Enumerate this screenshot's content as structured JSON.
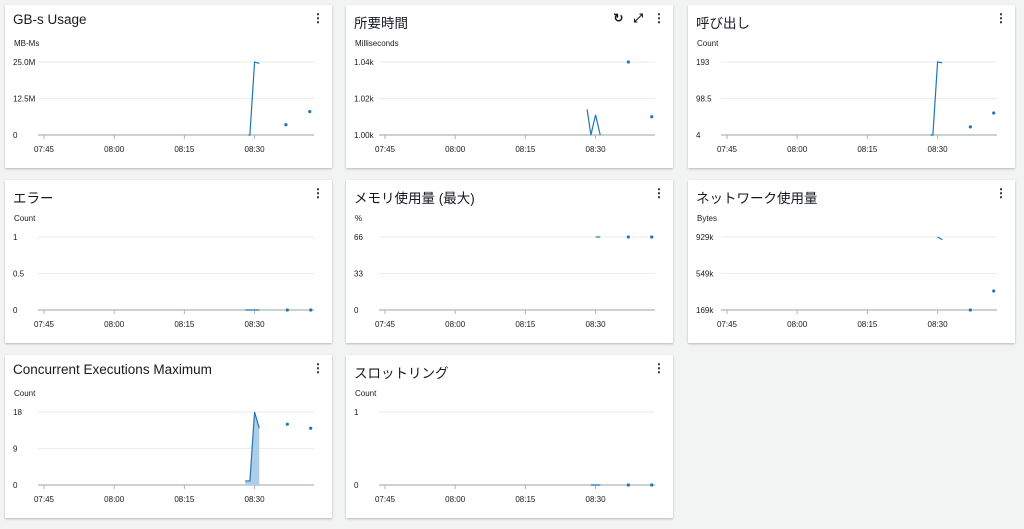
{
  "colors": {
    "line": "#1f77b4",
    "fill": "#aecde6",
    "grid": "#eaeded",
    "axis": "#aab7b8"
  },
  "x_ticks": [
    "07:45",
    "08:00",
    "08:15",
    "08:30"
  ],
  "x_range": [
    "07:45",
    "08:42.7"
  ],
  "chart_data": [
    {
      "type": "line",
      "title": "GB-s Usage",
      "unit": "MB-Ms",
      "yticks": [
        "0",
        "12.5M",
        "25.0M"
      ],
      "ylim": [
        0,
        25000000
      ],
      "line": [
        [
          "08:28.7",
          0
        ],
        [
          "08:29",
          0
        ],
        [
          "08:30",
          25000000
        ],
        [
          "08:31",
          24500000
        ]
      ],
      "dots": [
        [
          "08:36.7",
          3500000
        ],
        [
          "08:41.8",
          8000000
        ]
      ]
    },
    {
      "type": "line",
      "title": "所要時間",
      "unit": "Milliseconds",
      "yticks": [
        "1.00k",
        "1.02k",
        "1.04k"
      ],
      "ylim": [
        1000,
        1040
      ],
      "extra_tools": true,
      "line": [
        [
          "08:28.2",
          1014
        ],
        [
          "08:29",
          1000
        ],
        [
          "08:30",
          1011
        ],
        [
          "08:31",
          1000
        ]
      ],
      "dots": [
        [
          "08:37",
          1040
        ],
        [
          "08:42",
          1010
        ]
      ]
    },
    {
      "type": "line",
      "title": "呼び出し",
      "unit": "Count",
      "yticks": [
        "4",
        "98.5",
        "193"
      ],
      "ylim": [
        4,
        193
      ],
      "line": [
        [
          "08:28.5",
          4
        ],
        [
          "08:29",
          4
        ],
        [
          "08:30",
          193
        ],
        [
          "08:31",
          191
        ]
      ],
      "dots": [
        [
          "08:37",
          25
        ],
        [
          "08:42",
          61
        ]
      ]
    },
    {
      "type": "line",
      "title": "エラー",
      "unit": "Count",
      "yticks": [
        "0",
        "0.5",
        "1"
      ],
      "ylim": [
        0,
        1
      ],
      "line": [
        [
          "08:28",
          0
        ],
        [
          "08:31",
          0
        ]
      ],
      "dots": [
        [
          "08:37",
          0
        ],
        [
          "08:42",
          0
        ]
      ]
    },
    {
      "type": "line",
      "title": "メモリ使用量 (最大)",
      "unit": "%",
      "yticks": [
        "0",
        "33",
        "66"
      ],
      "ylim": [
        0,
        66
      ],
      "line": [
        [
          "08:30",
          66
        ],
        [
          "08:31",
          66
        ]
      ],
      "dots": [
        [
          "08:37",
          66
        ],
        [
          "08:42",
          66
        ]
      ]
    },
    {
      "type": "line",
      "title": "ネットワーク使用量",
      "unit": "Bytes",
      "yticks": [
        "169k",
        "549k",
        "929k"
      ],
      "ylim": [
        169,
        929
      ],
      "line": [
        [
          "08:30",
          929
        ],
        [
          "08:31",
          900
        ]
      ],
      "dots": [
        [
          "08:37",
          169
        ],
        [
          "08:42",
          367
        ]
      ]
    },
    {
      "type": "area",
      "title": "Concurrent Executions Maximum",
      "unit": "Count",
      "yticks": [
        "0",
        "9",
        "18"
      ],
      "ylim": [
        0,
        18
      ],
      "line": [
        [
          "08:28",
          1
        ],
        [
          "08:29",
          1
        ],
        [
          "08:30",
          18
        ],
        [
          "08:31",
          14
        ]
      ],
      "dots": [
        [
          "08:37",
          15
        ],
        [
          "08:42",
          14
        ]
      ]
    },
    {
      "type": "line",
      "title": "スロットリング",
      "unit": "Count",
      "yticks": [
        "0",
        "1"
      ],
      "ylim": [
        0,
        1
      ],
      "line": [
        [
          "08:29",
          0
        ],
        [
          "08:31",
          0
        ]
      ],
      "dots": [
        [
          "08:37",
          0
        ],
        [
          "08:42",
          0
        ]
      ]
    }
  ],
  "tools": {
    "refresh": "↻",
    "expand": "⤢",
    "menu": "⋮"
  }
}
